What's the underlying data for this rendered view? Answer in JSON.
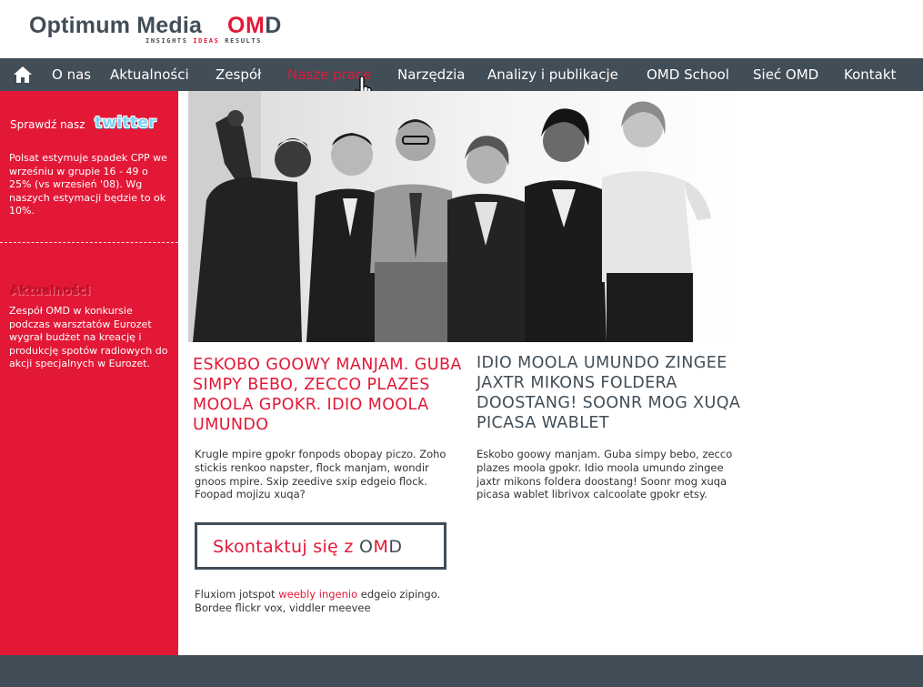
{
  "colors": {
    "brand_dark": "#414d57",
    "brand_red": "#e31837",
    "twitter_blue": "#7cd3f3"
  },
  "logo": {
    "name": "Optimum Media",
    "omd_o": "O",
    "omd_m": "M",
    "omd_d": "D",
    "tag_insights": "INSIGHTS",
    "tag_ideas": "IDEAS",
    "tag_results": "RESULTS"
  },
  "nav": {
    "home_icon": "home-icon",
    "items": [
      "O nas",
      "Aktualności",
      "Zespół",
      "Nasze prace",
      "Narzędzia",
      "Analizy i publikacje",
      "OMD School",
      "Sieć OMD",
      "Kontakt"
    ],
    "active": "Nasze prace"
  },
  "sidebar": {
    "twitter_label": "Sprawdź nasz",
    "twitter_logo": "twitter",
    "tweet": "Polsat estymuje spadek CPP we wrześniu w grupie 16 - 49 o 25% (vs wrzesień '08). Wg naszych estymacji będzie to ok 10%.",
    "news_title": "Aktualności",
    "news_text": "Zespół OMD w konkursie podczas warsztatów Eurozet wygrał budżet na kreację i produkcję spotów radiowych do akcji specjalnych w Eurozet."
  },
  "main": {
    "headline_left": "ESKOBO GOOWY MANJAM. GUBA SIMPY BEBO, ZECCO PLAZES MOOLA GPOKR. IDIO MOOLA UMUNDO",
    "headline_right": "IDIO MOOLA UMUNDO ZINGEE JAXTR MIKONS FOLDERA DOOSTANG! SOONR MOG XUQA PICASA WABLET",
    "body_left": "Krugle mpire gpokr fonpods obopay piczo. Zoho stickis renkoo napster, flock manjam, wondir gnoos mpire. Sxip zeedive sxip edgeio flock. Foopad mojizu xuqa?",
    "body_right": "Eskobo goowy manjam. Guba simpy bebo, zecco plazes moola gpokr. Idio moola umundo zingee jaxtr mikons foldera doostang! Soonr mog xuqa picasa wablet librivox calcoolate gpokr etsy.",
    "contact_label": "Skontaktuj się z",
    "contact_o": "O",
    "contact_m": "M",
    "contact_d": "D",
    "footnote_before": "Fluxiom jotspot",
    "footnote_link": "weebly ingenio",
    "footnote_after": "edgeio zipingo. Bordee flickr vox, viddler meevee"
  },
  "hero": {
    "description_icon": "team-photo-image"
  }
}
